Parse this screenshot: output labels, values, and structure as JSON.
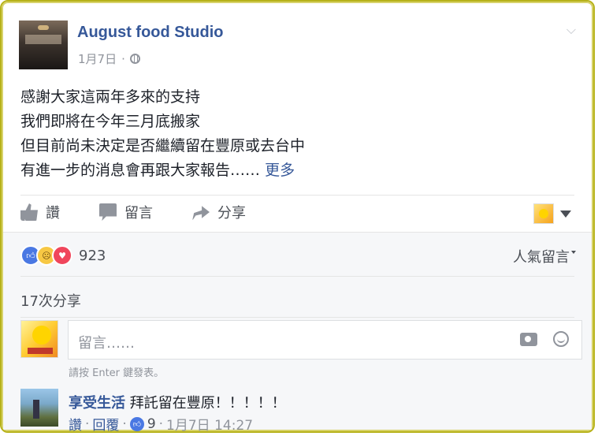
{
  "post": {
    "page_name": "August food Studio",
    "date": "1月7日",
    "separator": "·",
    "lines": [
      "感謝大家這兩年多來的支持",
      "我們即將在今年三月底搬家",
      "但目前尚未決定是否繼續留在豐原或去台中",
      "有進一步的消息會再跟大家報告……"
    ],
    "more_link": "更多"
  },
  "actions": {
    "like_label": "讚",
    "comment_label": "留言",
    "share_label": "分享"
  },
  "reactions": {
    "count": "923",
    "sort_label": "人氣留言",
    "types": [
      "like",
      "sad",
      "love"
    ]
  },
  "shares": {
    "label": "17次分享"
  },
  "composer": {
    "placeholder": "留言……",
    "hint": "請按 Enter 鍵發表。"
  },
  "comment": {
    "author": "享受生活",
    "text": "拜託留在豐原！！！！！",
    "like_link": "讚",
    "reply_link": "回覆",
    "like_count": "9",
    "dot": "·",
    "timestamp": "1月7日 14:27"
  },
  "colors": {
    "frame": "#b7b21a",
    "link_blue": "#365899",
    "secondary_text": "#90949c",
    "body_text": "#1d2129"
  }
}
